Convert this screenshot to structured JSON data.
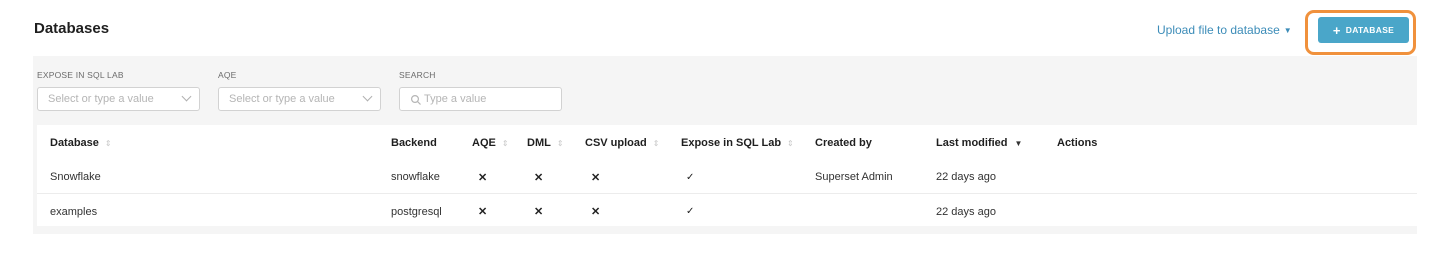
{
  "header": {
    "title": "Databases",
    "upload_link": "Upload file to database",
    "add_button": "DATABASE"
  },
  "filters": {
    "expose": {
      "label": "EXPOSE IN SQL LAB",
      "placeholder": "Select or type a value"
    },
    "aqe": {
      "label": "AQE",
      "placeholder": "Select or type a value"
    },
    "search": {
      "label": "SEARCH",
      "placeholder": "Type a value"
    }
  },
  "table": {
    "columns": {
      "database": "Database",
      "backend": "Backend",
      "aqe": "AQE",
      "dml": "DML",
      "csv": "CSV upload",
      "expose": "Expose in SQL Lab",
      "created_by": "Created by",
      "modified": "Last modified",
      "actions": "Actions"
    },
    "rows": [
      {
        "database": "Snowflake",
        "backend": "snowflake",
        "aqe": "✕",
        "dml": "✕",
        "csv": "✕",
        "expose": "✓",
        "created_by": "Superset Admin",
        "modified": "22 days ago"
      },
      {
        "database": "examples",
        "backend": "postgresql",
        "aqe": "✕",
        "dml": "✕",
        "csv": "✕",
        "expose": "✓",
        "created_by": "",
        "modified": "22 days ago"
      }
    ]
  },
  "icons": {
    "sort_neutral": "sort-icon",
    "sort_desc": "sort-desc-icon",
    "search": "search-icon"
  },
  "colors": {
    "primary": "#4aa6c9",
    "link": "#3c8cb8",
    "highlight": "#f0913c"
  }
}
